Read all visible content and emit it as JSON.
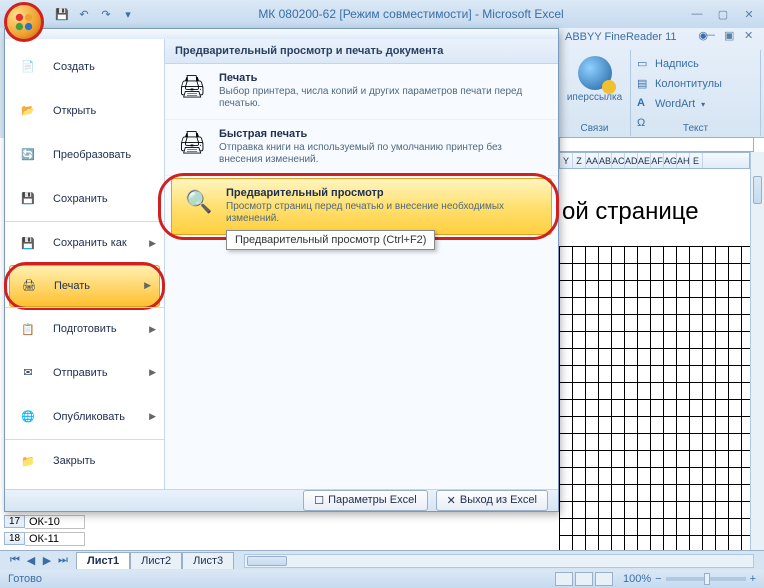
{
  "title": "МК 080200-62  [Режим совместимости] - Microsoft Excel",
  "ribbon": {
    "tab_label": "ABBYY FineReader 11",
    "hyperlink_label": "иперссылка",
    "group1_label": "Связи",
    "items": [
      "Надпись",
      "Колонтитулы",
      "WordArt"
    ],
    "group2_label": "Текст",
    "omega": "Ω"
  },
  "menu": {
    "header": "Предварительный просмотр и печать документа",
    "left": [
      {
        "label": "Создать"
      },
      {
        "label": "Открыть"
      },
      {
        "label": "Преобразовать"
      },
      {
        "label": "Сохранить"
      },
      {
        "label": "Сохранить как",
        "arrow": true,
        "sep": true
      },
      {
        "label": "Печать",
        "arrow": true,
        "active": true,
        "sep": true
      },
      {
        "label": "Подготовить",
        "arrow": true,
        "sep": true
      },
      {
        "label": "Отправить",
        "arrow": true
      },
      {
        "label": "Опубликовать",
        "arrow": true
      },
      {
        "label": "Закрыть",
        "sep": true
      }
    ],
    "right": [
      {
        "title": "Печать",
        "desc": "Выбор принтера, числа копий и других параметров печати перед печатью."
      },
      {
        "title": "Быстрая печать",
        "desc": "Отправка книги на используемый по умолчанию принтер без внесения изменений."
      },
      {
        "title": "Предварительный просмотр",
        "desc": "Просмотр страниц перед печатью и внесение необходимых изменений.",
        "hl": true
      }
    ],
    "tooltip": "Предварительный просмотр (Ctrl+F2)",
    "footer": {
      "options": "Параметры Excel",
      "exit": "Выход из Excel"
    }
  },
  "sheet": {
    "cols": [
      "Y",
      "Z",
      "AA",
      "AB",
      "AC",
      "AD",
      "AE",
      "AF",
      "AG",
      "AH",
      "E"
    ],
    "big_text": "ой странице",
    "rows_below": [
      {
        "n": "17",
        "val": "ОК-10"
      },
      {
        "n": "18",
        "val": "ОК-11"
      }
    ],
    "tabs": [
      "Лист1",
      "Лист2",
      "Лист3"
    ]
  },
  "status": {
    "ready": "Готово",
    "zoom": "100%"
  }
}
